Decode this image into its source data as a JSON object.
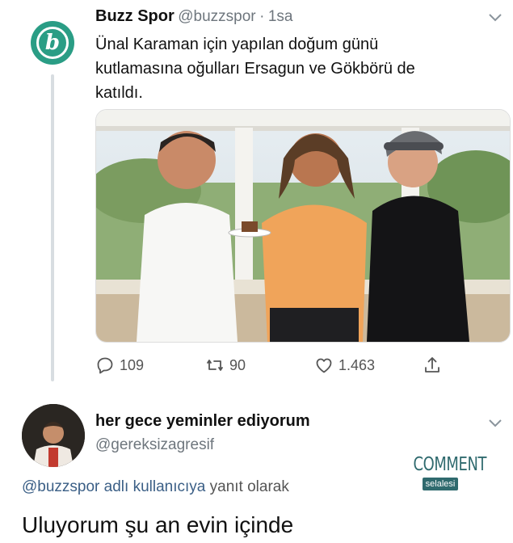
{
  "tweet": {
    "display_name": "Buzz Spor",
    "handle": "@buzzspor",
    "separator": "·",
    "time": "1sa",
    "text_lines": [
      "Ünal Karaman için yapılan doğum günü",
      "kutlamasına oğulları Ersagun ve Gökbörü de",
      "katıldı."
    ],
    "avatar_letter": "b",
    "avatar_color": "#2a9d85",
    "actions": {
      "replies": "109",
      "retweets": "90",
      "likes": "1.463"
    }
  },
  "reply": {
    "display_name": "her gece yeminler ediyorum",
    "handle": "@gereksizagresif",
    "replying_mention": "@buzzspor adlı kullanıcıya",
    "replying_suffix": "yanıt olarak",
    "text": "Uluyorum şu an evin içinde"
  },
  "watermark": {
    "line1": "COMMENT",
    "line2": "selalesi"
  },
  "colors": {
    "text": "#111111",
    "secondary": "#6e767d",
    "mention": "#3b5f86",
    "watermark": "#2f6a6e"
  },
  "icons": [
    "reply-icon",
    "retweet-icon",
    "like-icon",
    "share-icon",
    "chevron-down-icon"
  ]
}
